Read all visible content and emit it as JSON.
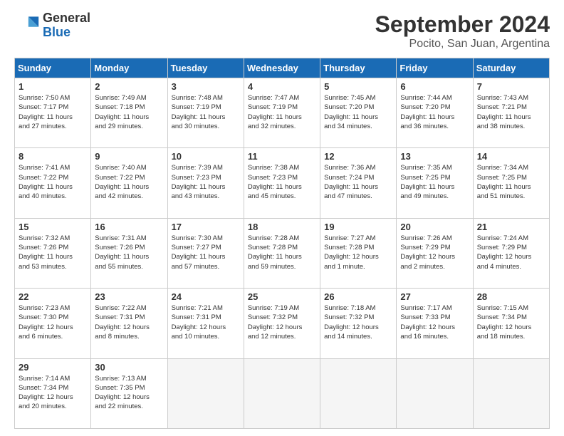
{
  "logo": {
    "general": "General",
    "blue": "Blue"
  },
  "title": "September 2024",
  "subtitle": "Pocito, San Juan, Argentina",
  "headers": [
    "Sunday",
    "Monday",
    "Tuesday",
    "Wednesday",
    "Thursday",
    "Friday",
    "Saturday"
  ],
  "weeks": [
    [
      {
        "day": "1",
        "info": "Sunrise: 7:50 AM\nSunset: 7:17 PM\nDaylight: 11 hours\nand 27 minutes."
      },
      {
        "day": "2",
        "info": "Sunrise: 7:49 AM\nSunset: 7:18 PM\nDaylight: 11 hours\nand 29 minutes."
      },
      {
        "day": "3",
        "info": "Sunrise: 7:48 AM\nSunset: 7:19 PM\nDaylight: 11 hours\nand 30 minutes."
      },
      {
        "day": "4",
        "info": "Sunrise: 7:47 AM\nSunset: 7:19 PM\nDaylight: 11 hours\nand 32 minutes."
      },
      {
        "day": "5",
        "info": "Sunrise: 7:45 AM\nSunset: 7:20 PM\nDaylight: 11 hours\nand 34 minutes."
      },
      {
        "day": "6",
        "info": "Sunrise: 7:44 AM\nSunset: 7:20 PM\nDaylight: 11 hours\nand 36 minutes."
      },
      {
        "day": "7",
        "info": "Sunrise: 7:43 AM\nSunset: 7:21 PM\nDaylight: 11 hours\nand 38 minutes."
      }
    ],
    [
      {
        "day": "8",
        "info": "Sunrise: 7:41 AM\nSunset: 7:22 PM\nDaylight: 11 hours\nand 40 minutes."
      },
      {
        "day": "9",
        "info": "Sunrise: 7:40 AM\nSunset: 7:22 PM\nDaylight: 11 hours\nand 42 minutes."
      },
      {
        "day": "10",
        "info": "Sunrise: 7:39 AM\nSunset: 7:23 PM\nDaylight: 11 hours\nand 43 minutes."
      },
      {
        "day": "11",
        "info": "Sunrise: 7:38 AM\nSunset: 7:23 PM\nDaylight: 11 hours\nand 45 minutes."
      },
      {
        "day": "12",
        "info": "Sunrise: 7:36 AM\nSunset: 7:24 PM\nDaylight: 11 hours\nand 47 minutes."
      },
      {
        "day": "13",
        "info": "Sunrise: 7:35 AM\nSunset: 7:25 PM\nDaylight: 11 hours\nand 49 minutes."
      },
      {
        "day": "14",
        "info": "Sunrise: 7:34 AM\nSunset: 7:25 PM\nDaylight: 11 hours\nand 51 minutes."
      }
    ],
    [
      {
        "day": "15",
        "info": "Sunrise: 7:32 AM\nSunset: 7:26 PM\nDaylight: 11 hours\nand 53 minutes."
      },
      {
        "day": "16",
        "info": "Sunrise: 7:31 AM\nSunset: 7:26 PM\nDaylight: 11 hours\nand 55 minutes."
      },
      {
        "day": "17",
        "info": "Sunrise: 7:30 AM\nSunset: 7:27 PM\nDaylight: 11 hours\nand 57 minutes."
      },
      {
        "day": "18",
        "info": "Sunrise: 7:28 AM\nSunset: 7:28 PM\nDaylight: 11 hours\nand 59 minutes."
      },
      {
        "day": "19",
        "info": "Sunrise: 7:27 AM\nSunset: 7:28 PM\nDaylight: 12 hours\nand 1 minute."
      },
      {
        "day": "20",
        "info": "Sunrise: 7:26 AM\nSunset: 7:29 PM\nDaylight: 12 hours\nand 2 minutes."
      },
      {
        "day": "21",
        "info": "Sunrise: 7:24 AM\nSunset: 7:29 PM\nDaylight: 12 hours\nand 4 minutes."
      }
    ],
    [
      {
        "day": "22",
        "info": "Sunrise: 7:23 AM\nSunset: 7:30 PM\nDaylight: 12 hours\nand 6 minutes."
      },
      {
        "day": "23",
        "info": "Sunrise: 7:22 AM\nSunset: 7:31 PM\nDaylight: 12 hours\nand 8 minutes."
      },
      {
        "day": "24",
        "info": "Sunrise: 7:21 AM\nSunset: 7:31 PM\nDaylight: 12 hours\nand 10 minutes."
      },
      {
        "day": "25",
        "info": "Sunrise: 7:19 AM\nSunset: 7:32 PM\nDaylight: 12 hours\nand 12 minutes."
      },
      {
        "day": "26",
        "info": "Sunrise: 7:18 AM\nSunset: 7:32 PM\nDaylight: 12 hours\nand 14 minutes."
      },
      {
        "day": "27",
        "info": "Sunrise: 7:17 AM\nSunset: 7:33 PM\nDaylight: 12 hours\nand 16 minutes."
      },
      {
        "day": "28",
        "info": "Sunrise: 7:15 AM\nSunset: 7:34 PM\nDaylight: 12 hours\nand 18 minutes."
      }
    ],
    [
      {
        "day": "29",
        "info": "Sunrise: 7:14 AM\nSunset: 7:34 PM\nDaylight: 12 hours\nand 20 minutes."
      },
      {
        "day": "30",
        "info": "Sunrise: 7:13 AM\nSunset: 7:35 PM\nDaylight: 12 hours\nand 22 minutes."
      },
      {
        "day": "",
        "info": ""
      },
      {
        "day": "",
        "info": ""
      },
      {
        "day": "",
        "info": ""
      },
      {
        "day": "",
        "info": ""
      },
      {
        "day": "",
        "info": ""
      }
    ]
  ]
}
